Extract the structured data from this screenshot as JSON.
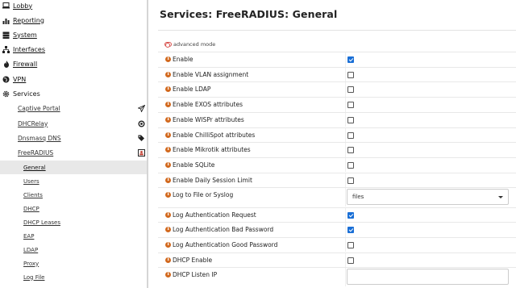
{
  "sidebar": {
    "items": [
      {
        "label": "Lobby",
        "icon": "laptop-icon"
      },
      {
        "label": "Reporting",
        "icon": "chart-icon"
      },
      {
        "label": "System",
        "icon": "server-icon"
      },
      {
        "label": "Interfaces",
        "icon": "network-icon"
      },
      {
        "label": "Firewall",
        "icon": "fire-icon"
      },
      {
        "label": "VPN",
        "icon": "globe-icon"
      },
      {
        "label": "Services",
        "icon": "gear-icon"
      }
    ],
    "services_sub": [
      {
        "label": "Captive Portal",
        "icon": "paper-plane-icon"
      },
      {
        "label": "DHCRelay",
        "icon": "bullseye-icon"
      },
      {
        "label": "Dnsmasq DNS",
        "icon": "tags-icon"
      },
      {
        "label": "FreeRADIUS",
        "icon": "user-card-icon"
      }
    ],
    "freeradius_sub": [
      {
        "label": "General",
        "active": true
      },
      {
        "label": "Users"
      },
      {
        "label": "Clients"
      },
      {
        "label": "DHCP"
      },
      {
        "label": "DHCP Leases"
      },
      {
        "label": "EAP"
      },
      {
        "label": "LDAP"
      },
      {
        "label": "Proxy"
      },
      {
        "label": "Log File"
      }
    ]
  },
  "main": {
    "title": "Services: FreeRADIUS: General",
    "advanced_mode_label": "advanced mode",
    "rows": [
      {
        "label": "Enable",
        "type": "checkbox",
        "checked": true
      },
      {
        "label": "Enable VLAN assignment",
        "type": "checkbox",
        "checked": false
      },
      {
        "label": "Enable LDAP",
        "type": "checkbox",
        "checked": false
      },
      {
        "label": "Enable EXOS attributes",
        "type": "checkbox",
        "checked": false
      },
      {
        "label": "Enable WISPr attributes",
        "type": "checkbox",
        "checked": false
      },
      {
        "label": "Enable ChilliSpot attributes",
        "type": "checkbox",
        "checked": false
      },
      {
        "label": "Enable Mikrotik attributes",
        "type": "checkbox",
        "checked": false
      },
      {
        "label": "Enable SQLite",
        "type": "checkbox",
        "checked": false
      },
      {
        "label": "Enable Daily Session Limit",
        "type": "checkbox",
        "checked": false
      },
      {
        "label": "Log to File or Syslog",
        "type": "select",
        "value": "files"
      },
      {
        "label": "Log Authentication Request",
        "type": "checkbox",
        "checked": true
      },
      {
        "label": "Log Authentication Bad Password",
        "type": "checkbox",
        "checked": true
      },
      {
        "label": "Log Authentication Good Password",
        "type": "checkbox",
        "checked": false
      },
      {
        "label": "DHCP Enable",
        "type": "checkbox",
        "checked": false
      },
      {
        "label": "DHCP Listen IP",
        "type": "text",
        "value": ""
      }
    ]
  },
  "colors": {
    "accent": "#1a6fd6",
    "info_icon": "#d2691e",
    "toggle": "#d9534f",
    "active_bg": "#e8e8e8"
  }
}
